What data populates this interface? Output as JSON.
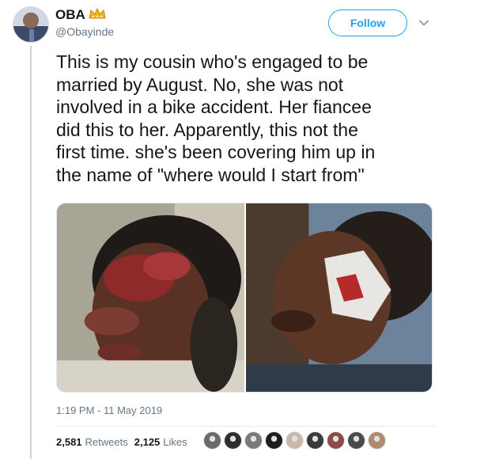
{
  "tweet": {
    "user": {
      "name": "OBA",
      "handle": "@Obayinde",
      "avatar_icon": "profile-photo",
      "badge_icon": "crown-icon"
    },
    "follow_label": "Follow",
    "text": "This is my cousin who's engaged to be\nmarried by August. No, she was not\ninvolved in a bike accident. Her fiancee\ndid this to her. Apparently, this not the\nfirst time. she's been covering him up in\nthe name of \"where would I start from\"",
    "media": [
      {
        "icon": "photo-woman-injured-face"
      },
      {
        "icon": "photo-woman-bandaged-face"
      }
    ],
    "timestamp": "1:19 PM - 11 May 2019",
    "stats": {
      "retweets_count": "2,581",
      "retweets_label": "Retweets",
      "likes_count": "2,125",
      "likes_label": "Likes"
    },
    "likers": [
      {
        "color": "#6b6b6b"
      },
      {
        "color": "#2e2e2e"
      },
      {
        "color": "#7a7a7a"
      },
      {
        "color": "#1e1e1e"
      },
      {
        "color": "#c9b8a8"
      },
      {
        "color": "#3a3a3a"
      },
      {
        "color": "#8c4a4a"
      },
      {
        "color": "#4a4a4a"
      },
      {
        "color": "#b08a6a"
      }
    ]
  },
  "colors": {
    "accent": "#1da1f2",
    "text_primary": "#14171a",
    "text_secondary": "#657786"
  }
}
